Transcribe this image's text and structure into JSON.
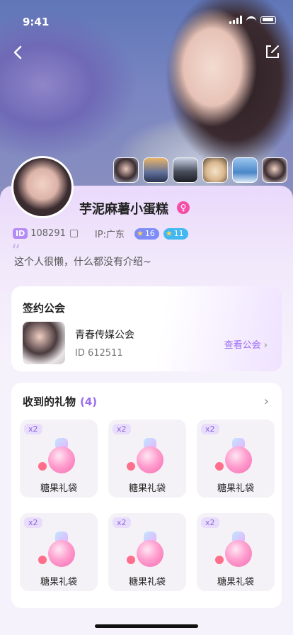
{
  "status": {
    "time": "9:41"
  },
  "profile": {
    "name": "芋泥麻薯小蛋糕",
    "gender_symbol": "♀",
    "id_badge": "ID",
    "id": "108291",
    "ip": "IP:广东",
    "level1": "16",
    "level2": "11",
    "intro": "这个人很懒，什么都没有介绍~"
  },
  "guild": {
    "title": "签约公会",
    "name": "青春传媒公会",
    "id": "ID 612511",
    "link": "查看公会"
  },
  "gifts": {
    "title": "收到的礼物",
    "count": "(4)",
    "items": [
      {
        "qty": "x2",
        "name": "糖果礼袋"
      },
      {
        "qty": "x2",
        "name": "糖果礼袋"
      },
      {
        "qty": "x2",
        "name": "糖果礼袋"
      },
      {
        "qty": "x2",
        "name": "糖果礼袋"
      },
      {
        "qty": "x2",
        "name": "糖果礼袋"
      },
      {
        "qty": "x2",
        "name": "糖果礼袋"
      }
    ]
  },
  "colors": {
    "accent": "#9b6bf0",
    "gender": "#f44fa7"
  }
}
